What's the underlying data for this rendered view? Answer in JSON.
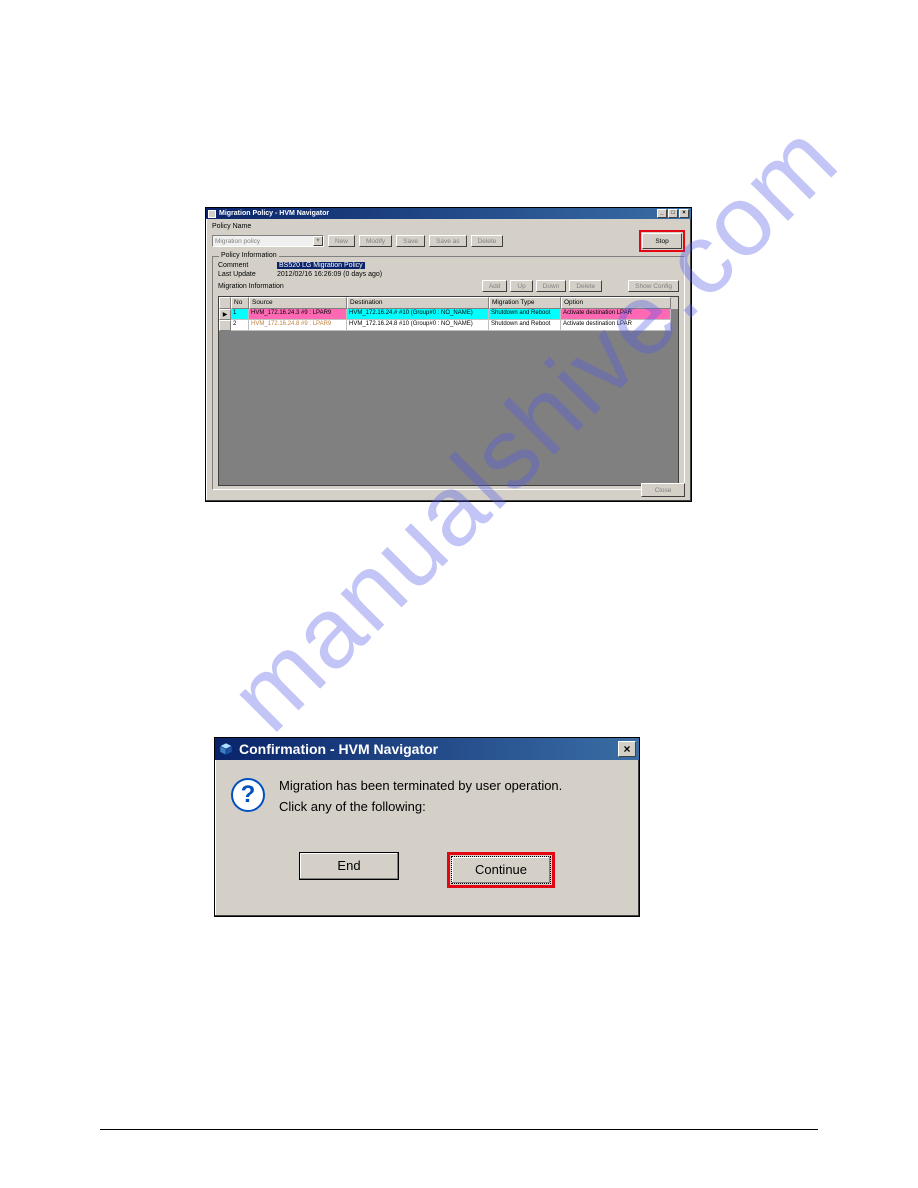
{
  "watermark": "manualshive.com",
  "win1": {
    "title": "Migration Policy - HVM Navigator",
    "policyNameLabel": "Policy Name",
    "policyNameValue": "Migration policy",
    "buttons": {
      "new": "New",
      "modify": "Modify",
      "save": "Save",
      "saveAs": "Save as",
      "delete": "Delete",
      "stop": "Stop",
      "close": "Close",
      "showConfig": "Show Config"
    },
    "policyInfo": {
      "legend": "Policy Information",
      "commentLabel": "Comment",
      "commentValue": "BS520 LG Migration Policy",
      "lastUpdateLabel": "Last Update",
      "lastUpdateValue": "2012/02/16 16:26:09 (0 days ago)",
      "migInfoLabel": "Migration Information",
      "migBtns": {
        "add": "Add",
        "up": "Up",
        "down": "Down",
        "delete": "Delete"
      }
    },
    "grid": {
      "headers": {
        "no": "No",
        "source": "Source",
        "destination": "Destination",
        "migType": "Migration Type",
        "option": "Option"
      },
      "rows": [
        {
          "no": "1",
          "source": "HVM_172.16.24.3    #9 : LPAR9",
          "destination": "HVM_172.16.24.#    #10    (Group#0 : NO_NAME)",
          "migType": "Shutdown and Reboot",
          "option": "Activate destination LPAR"
        },
        {
          "no": "2",
          "source": "HVM_172.16.24.8    #9 : LPAR9",
          "destination": "HVM_172.16.24.8    #10    (Group#0 : NO_NAME)",
          "migType": "Shutdown and Reboot",
          "option": "Activate destination LPAR"
        }
      ]
    }
  },
  "win2": {
    "title": "Confirmation - HVM Navigator",
    "line1": "Migration has been terminated by user operation.",
    "line2": "Click any of the following:",
    "endBtn": "End",
    "continueBtn": "Continue"
  }
}
